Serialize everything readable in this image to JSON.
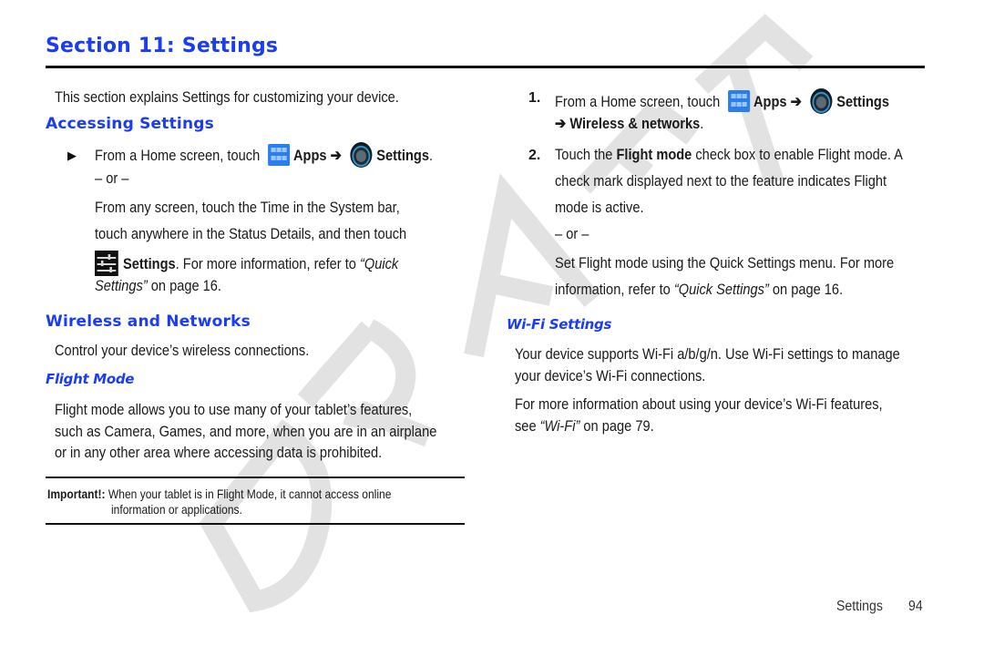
{
  "page": {
    "section_title": "Section 11: Settings",
    "watermark": "DRAFT",
    "footer": {
      "section": "Settings",
      "page_number": "94"
    }
  },
  "left": {
    "intro": "This section explains Settings for customizing your device.",
    "accessing": {
      "heading": "Accessing Settings",
      "step_prefix": "From a Home screen, touch",
      "apps_label": "Apps",
      "arrow": "➔",
      "settings_label": "Settings",
      "period": ".",
      "or": "– or –",
      "alt_line1": "From any screen, touch the Time in the System bar,",
      "alt_line2": "touch anywhere in the Status Details, and then touch",
      "alt_settings_label": "Settings",
      "alt_line3_rest": ". For more information, refer to ",
      "alt_ref_open": "“Quick",
      "alt_ref_close": "Settings”",
      "alt_line4_rest": " on page 16."
    },
    "wireless": {
      "heading": "Wireless and Networks",
      "intro": "Control your device’s wireless connections."
    },
    "flight": {
      "heading": "Flight Mode",
      "line1": "Flight mode allows you to use many of your tablet’s features,",
      "line2": "such as Camera, Games, and more, when you are in an airplane",
      "line3": "or in any other area where accessing data is prohibited."
    },
    "note": {
      "label": "Important!:",
      "line1": " When your tablet is in Flight Mode, it cannot access online",
      "line2": "information or applications."
    }
  },
  "right": {
    "steps": [
      {
        "number": "1.",
        "prefix": "From a Home screen,  touch",
        "apps_label": "Apps",
        "arrow": "➔",
        "settings_label": "Settings",
        "line2_arrow": "➔",
        "line2_bold": "Wireless & networks",
        "line2_end": "."
      },
      {
        "number": "2.",
        "line1_pre": "Touch the ",
        "line1_bold": "Flight mode",
        "line1_post": " check box to enable Flight mode. A",
        "line2": "check mark displayed next to the feature indicates Flight",
        "line3": "mode is active."
      }
    ],
    "or": "– or –",
    "quick_line1": "Set Flight mode using the Quick Settings menu. For more",
    "quick_line2_pre": "information, refer to ",
    "quick_line2_ref": "“Quick Settings”",
    "quick_line2_post": "  on page 16.",
    "wifi": {
      "heading": "Wi-Fi Settings",
      "para1_line1": "Your device supports Wi-Fi a/b/g/n. Use Wi-Fi settings to manage",
      "para1_line2": "your device’s Wi-Fi connections.",
      "para2_line1": "For more information about using your device’s Wi-Fi features,",
      "para2_line2_pre": "see ",
      "para2_line2_ref": "“Wi-Fi”",
      "para2_line2_post": " on page 79."
    }
  },
  "colors": {
    "heading_blue": "#1a3cf5",
    "watermark_gray": "#e3e3e3",
    "rule": "#111111"
  }
}
